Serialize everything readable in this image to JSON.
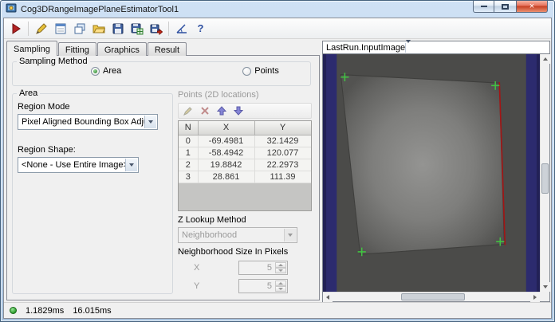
{
  "window": {
    "title": "Cog3DRangeImagePlaneEstimatorTool1"
  },
  "toolbar": {
    "icons": [
      "run-icon",
      "edit-tool-icon",
      "tool-window-icon",
      "cascade-windows-icon",
      "open-icon",
      "save-icon",
      "save-record-icon",
      "export-icon",
      "angle-icon",
      "help-icon"
    ],
    "help_glyph": "?"
  },
  "tabs": [
    {
      "label": "Sampling",
      "active": true
    },
    {
      "label": "Fitting",
      "active": false
    },
    {
      "label": "Graphics",
      "active": false
    },
    {
      "label": "Result",
      "active": false
    }
  ],
  "sampling": {
    "group_label": "Sampling Method",
    "area_label": "Area",
    "points_label": "Points",
    "selected": "Area"
  },
  "area_group": {
    "label": "Area",
    "region_mode_label": "Region Mode",
    "region_mode_value": "Pixel Aligned Bounding Box Adjust Mask",
    "region_shape_label": "Region Shape:",
    "region_shape_value": "<None - Use Entire Image>"
  },
  "points_group": {
    "label": "Points (2D locations)",
    "columns": [
      "N",
      "X",
      "Y"
    ],
    "rows": [
      [
        "0",
        "-69.4981",
        "32.1429"
      ],
      [
        "1",
        "-58.4942",
        "120.077"
      ],
      [
        "2",
        "19.8842",
        "22.2973"
      ],
      [
        "3",
        "28.861",
        "111.39"
      ]
    ],
    "z_lookup_label": "Z Lookup Method",
    "z_lookup_value": "Neighborhood",
    "size_label": "Neighborhood Size In Pixels",
    "x_label": "X",
    "x_value": "5",
    "y_label": "Y",
    "y_value": "5"
  },
  "display": {
    "selector": "LastRun.InputImage"
  },
  "status": {
    "time1": "1.1829ms",
    "time2": "16.015ms"
  }
}
